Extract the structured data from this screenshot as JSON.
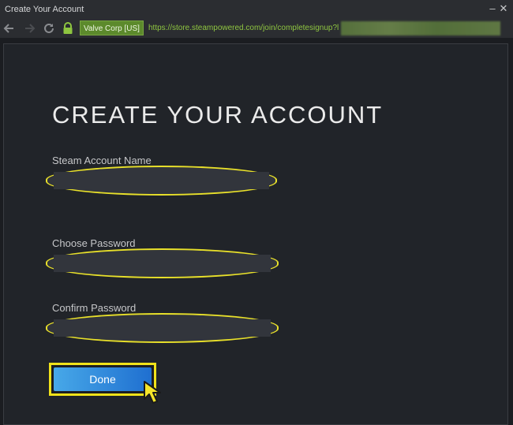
{
  "window": {
    "title": "Create Your Account",
    "minimize_glyph": "–",
    "close_glyph": "✕"
  },
  "navbar": {
    "cert_label": "Valve Corp [US]",
    "url": "https://store.steampowered.com/join/completesignup?l"
  },
  "form": {
    "heading": "CREATE YOUR ACCOUNT",
    "account_name_label": "Steam Account Name",
    "password_label": "Choose Password",
    "confirm_label": "Confirm Password",
    "account_name_value": "",
    "password_value": "",
    "confirm_value": "",
    "done_label": "Done"
  },
  "colors": {
    "highlight": "#e8e02a",
    "accent": "#47a8e8",
    "url_green": "#8ec540"
  }
}
